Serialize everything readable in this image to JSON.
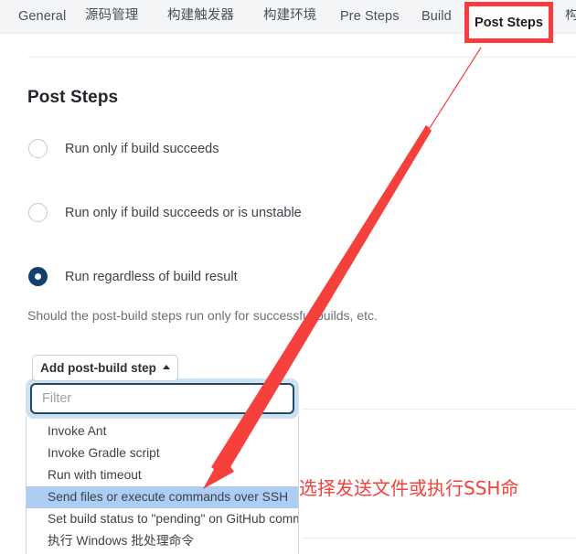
{
  "tabs": [
    {
      "label": "General",
      "active": false
    },
    {
      "label": "源码管理",
      "active": false
    },
    {
      "label": "构建触发器",
      "active": false
    },
    {
      "label": "构建环境",
      "active": false
    },
    {
      "label": "Pre Steps",
      "active": false
    },
    {
      "label": "Build",
      "active": false
    },
    {
      "label": "Post Steps",
      "active": true
    },
    {
      "label": "构",
      "active": false
    }
  ],
  "section": {
    "title": "Post Steps",
    "help_text": "Should the post-build steps run only for successful builds, etc."
  },
  "radios": [
    {
      "label": "Run only if build succeeds",
      "selected": false
    },
    {
      "label": "Run only if build succeeds or is unstable",
      "selected": false
    },
    {
      "label": "Run regardless of build result",
      "selected": true
    }
  ],
  "add_button": {
    "label": "Add post-build step",
    "caret": "caret-up-icon"
  },
  "dropdown": {
    "filter_placeholder": "Filter",
    "filter_value": "",
    "items": [
      {
        "label": "Invoke Ant",
        "selected": false
      },
      {
        "label": "Invoke Gradle script",
        "selected": false
      },
      {
        "label": "Run with timeout",
        "selected": false
      },
      {
        "label": "Send files or execute commands over SSH",
        "selected": true
      },
      {
        "label": "Set build status to \"pending\" on GitHub commit",
        "selected": false
      },
      {
        "label": "执行 Windows 批处理命令",
        "selected": false
      }
    ]
  },
  "annotation": {
    "text": "选择发送文件或执行SSH命",
    "color": "#f5403c"
  },
  "colors": {
    "tabbar_bg": "#f4f5f6",
    "highlight_red": "#fa3c3c",
    "radio_selected": "#13416b",
    "dropdown_selected_bg": "#aecdf5",
    "filter_border": "#1b4a6b",
    "filter_glow": "#cfe0ee",
    "annotation_red": "#f5403c"
  }
}
